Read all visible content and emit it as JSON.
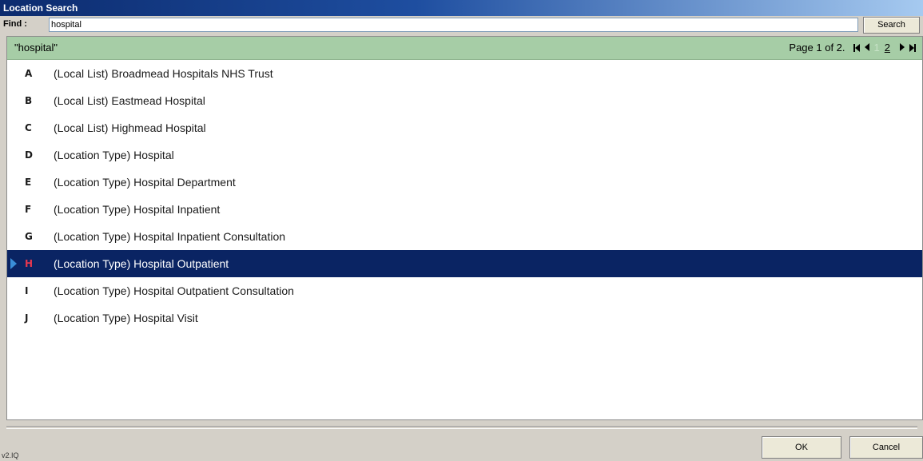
{
  "window": {
    "title": "Location Search"
  },
  "find": {
    "label": "Find :",
    "value": "hospital",
    "search_label": "Search"
  },
  "results": {
    "query_label": "\"hospital\"",
    "page_info": "Page 1 of 2.",
    "pages": [
      "1",
      "2"
    ],
    "current_page": "1"
  },
  "items": [
    {
      "letter": "A",
      "text": "(Local List) Broadmead Hospitals NHS Trust"
    },
    {
      "letter": "B",
      "text": "(Local List) Eastmead Hospital"
    },
    {
      "letter": "C",
      "text": "(Local List) Highmead Hospital"
    },
    {
      "letter": "D",
      "text": "(Location Type) Hospital"
    },
    {
      "letter": "E",
      "text": "(Location Type) Hospital Department"
    },
    {
      "letter": "F",
      "text": "(Location Type) Hospital Inpatient"
    },
    {
      "letter": "G",
      "text": "(Location Type) Hospital Inpatient Consultation"
    },
    {
      "letter": "H",
      "text": "(Location Type) Hospital Outpatient"
    },
    {
      "letter": "I",
      "text": "(Location Type) Hospital Outpatient Consultation"
    },
    {
      "letter": "J",
      "text": "(Location Type) Hospital Visit"
    }
  ],
  "selected_index": 7,
  "buttons": {
    "ok_label": "OK",
    "cancel_label": "Cancel"
  },
  "version": "v2.IQ",
  "icons": {
    "first": "first-page-icon",
    "prev": "previous-page-icon",
    "next": "next-page-icon",
    "last": "last-page-icon",
    "pointer": "row-pointer-icon"
  },
  "colors": {
    "title_bar": "#0c2b6e",
    "result_bar": "#a6cda6",
    "selection": "#0a2463",
    "selected_letter": "#e8384f",
    "pointer": "#3a8fd8"
  }
}
